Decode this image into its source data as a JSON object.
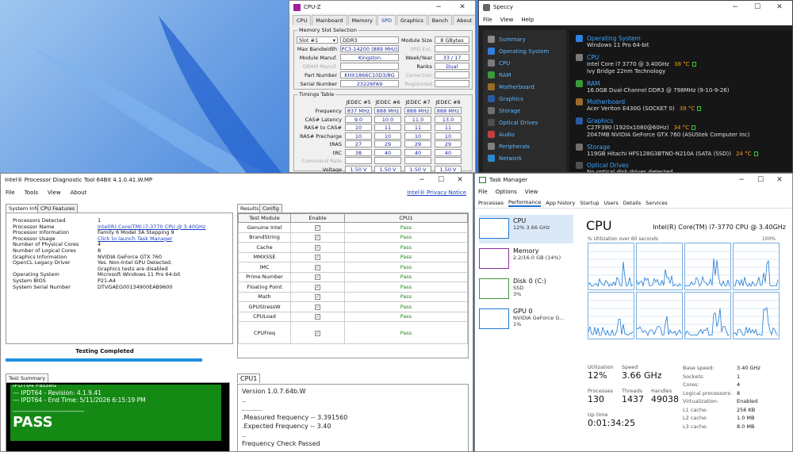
{
  "cpuz": {
    "title": "CPU-Z",
    "tabs": [
      "CPU",
      "Mainboard",
      "Memory",
      "SPD",
      "Graphics",
      "Bench",
      "About"
    ],
    "slot_group": "Memory Slot Selection",
    "slot": "Slot #1",
    "type": "DDR3",
    "module_size_label": "Module Size",
    "module_size": "8 GBytes",
    "max_bw_label": "Max Bandwidth",
    "max_bw": "PC3-14200 (889 MHz)",
    "spd_ext_label": "SPD Ext.",
    "manuf_label": "Module Manuf.",
    "manuf": "Kingston",
    "weekyear_label": "Week/Year",
    "weekyear": "33 / 17",
    "dram_label": "DRAM Manuf.",
    "ranks_label": "Ranks",
    "ranks": "Dual",
    "part_label": "Part Number",
    "part": "KHX1866C10D3/8G",
    "correction_label": "Correction",
    "serial_label": "Serial Number",
    "serial": "23226FA9",
    "registered_label": "Registered",
    "timings_group": "Timings Table",
    "timing_headers": [
      "JEDEC #5",
      "JEDEC #6",
      "JEDEC #7",
      "JEDEC #8"
    ],
    "timing_rows": [
      {
        "label": "Frequency",
        "vals": [
          "837 MHz",
          "888 MHz",
          "888 MHz",
          "888 MHz"
        ]
      },
      {
        "label": "CAS# Latency",
        "vals": [
          "9.0",
          "10.0",
          "11.0",
          "13.0"
        ]
      },
      {
        "label": "RAS# to CAS#",
        "vals": [
          "10",
          "11",
          "11",
          "11"
        ]
      },
      {
        "label": "RAS# Precharge",
        "vals": [
          "10",
          "10",
          "10",
          "10"
        ]
      },
      {
        "label": "tRAS",
        "vals": [
          "27",
          "29",
          "29",
          "29"
        ]
      },
      {
        "label": "tRC",
        "vals": [
          "38",
          "40",
          "40",
          "40"
        ]
      },
      {
        "label": "Command Rate",
        "vals": [
          "",
          "",
          "",
          ""
        ]
      },
      {
        "label": "Voltage",
        "vals": [
          "1.50 V",
          "1.50 V",
          "1.50 V",
          "1.50 V"
        ]
      }
    ]
  },
  "speccy": {
    "title": "Speccy",
    "menu": [
      "File",
      "View",
      "Help"
    ],
    "side": [
      {
        "label": "Summary",
        "color": "#8a8a8a"
      },
      {
        "label": "Operating System",
        "color": "#2f7fe0"
      },
      {
        "label": "CPU",
        "color": "#7a7a7a"
      },
      {
        "label": "RAM",
        "color": "#3a9a3a"
      },
      {
        "label": "Motherboard",
        "color": "#9a6a2a"
      },
      {
        "label": "Graphics",
        "color": "#2a5aa0"
      },
      {
        "label": "Storage",
        "color": "#707070"
      },
      {
        "label": "Optical Drives",
        "color": "#505050"
      },
      {
        "label": "Audio",
        "color": "#c04040"
      },
      {
        "label": "Peripherals",
        "color": "#808080"
      },
      {
        "label": "Network",
        "color": "#2a8ad0"
      }
    ],
    "sections": [
      {
        "head": "Operating System",
        "color": "#2f7fe0",
        "lines": [
          "Windows 11 Pro 64-bit"
        ]
      },
      {
        "head": "CPU",
        "color": "#7a7a7a",
        "lines": [
          "Intel Core i7 3770 @ 3.40GHz",
          "Ivy Bridge 22nm Technology"
        ],
        "temp": "38 °C"
      },
      {
        "head": "RAM",
        "color": "#3a9a3a",
        "lines": [
          "16.0GB Dual-Channel DDR3 @ 798MHz (9-10-9-26)"
        ]
      },
      {
        "head": "Motherboard",
        "color": "#9a6a2a",
        "lines": [
          "Acer Veriton E430G (SOCKET 0)"
        ],
        "temp": "39 °C"
      },
      {
        "head": "Graphics",
        "color": "#2a5aa0",
        "lines": [
          "C27F390 (1920x1080@60Hz)",
          "2047MB NVIDIA GeForce GTX 760 (ASUStek Computer Inc)"
        ],
        "temp": "34 °C"
      },
      {
        "head": "Storage",
        "color": "#707070",
        "lines": [
          "119GB Hitachi HFS128G3BTND-N210A (SATA (SSD))"
        ],
        "temp": "24 °C"
      },
      {
        "head": "Optical Drives",
        "color": "#505050",
        "lines": [
          "No optical disk drives detected"
        ]
      }
    ]
  },
  "ipdt": {
    "title": "Intel® Processor Diagnostic Tool 64Bit 4.1.0.41.W.MP",
    "menu": [
      "File",
      "Tools",
      "View",
      "About"
    ],
    "privacy": "Intel® Privacy Notice",
    "tab_sysinfo": "System Info",
    "tab_cpufeat": "CPU Features",
    "sysinfo": [
      [
        "Processors Detected",
        "1"
      ],
      [
        "Processor Name",
        "Intel(R) Core(TM) i7-3770 CPU @ 3.40GHz"
      ],
      [
        "Processor Information",
        "Family 6 Model 3A Stepping 9"
      ],
      [
        "Processor Usage",
        "Click to launch Task Manager"
      ],
      [
        "Number of Physical Cores",
        "4"
      ],
      [
        "Number of Logical Cores",
        "8"
      ],
      [
        "Graphics Information",
        "NVIDIA GeForce GTX 760"
      ],
      [
        "OpenCL Legacy Driver",
        "Yes. Non-Intel GPU Detected."
      ],
      [
        "",
        "Graphics tests are disabled"
      ],
      [
        "Operating System",
        "Microsoft Windows 11 Pro 64-bit"
      ],
      [
        "System BIOS",
        "P21-A4"
      ],
      [
        "System Serial Number",
        "DTVGAEG00134900EAB9600"
      ]
    ],
    "tab_results": "Results",
    "tab_config": "Config",
    "res_headers": [
      "Test Module",
      "Enable",
      "CPU1"
    ],
    "results": [
      {
        "name": "Genuine Intel",
        "res": "Pass"
      },
      {
        "name": "BrandString",
        "res": "Pass"
      },
      {
        "name": "Cache",
        "res": "Pass"
      },
      {
        "name": "MMXSSE",
        "res": "Pass"
      },
      {
        "name": "IMC",
        "res": "Pass"
      },
      {
        "name": "Prime Number",
        "res": "Pass"
      },
      {
        "name": "Floating Point",
        "res": "Pass"
      },
      {
        "name": "Math",
        "res": "Pass"
      },
      {
        "name": "GPUStressW",
        "res": "Pass"
      },
      {
        "name": "CPULoad",
        "res": "Pass"
      },
      {
        "name": "CPUFreq",
        "res": "Pass"
      }
    ],
    "testing_completed": "Testing Completed",
    "summary_tab": "Test Summary",
    "summary_lines": [
      "IPDT64 Passed",
      "--- IPDT64 - Revision: 4.1.9.41",
      "--- IPDT64 - End Time: 5/11/2026 6:15:19 PM",
      "________________________"
    ],
    "pass": "PASS",
    "cpu1_tab": "CPU1",
    "cpu1_lines": [
      "Version 1.0.7.64b.W",
      "..",
      "..........",
      ".Measured frequency -- 3.391560",
      ".Expected Frequency -- 3.40",
      "..",
      "Frequency Check Passed"
    ]
  },
  "tm": {
    "title": "Task Manager",
    "menu": [
      "File",
      "Options",
      "View"
    ],
    "tabs": [
      "Processes",
      "Performance",
      "App history",
      "Startup",
      "Users",
      "Details",
      "Services"
    ],
    "items": [
      {
        "name": "CPU",
        "sub": "12%  3.66 GHz",
        "color": "#1f7bd4"
      },
      {
        "name": "Memory",
        "sub": "2.2/16.0 GB (14%)",
        "color": "#8b2fa0"
      },
      {
        "name": "Disk 0 (C:)",
        "sub": "SSD",
        "sub2": "3%",
        "color": "#3a9a3a"
      },
      {
        "name": "GPU 0",
        "sub": "NVIDIA GeForce G...",
        "sub2": "1%",
        "color": "#1f7bd4"
      }
    ],
    "heading": "CPU",
    "cpu_name": "Intel(R) Core(TM) i7-3770 CPU @ 3.40GHz",
    "util_label": "% Utilization over 60 seconds",
    "util_max": "100%",
    "stats": {
      "utilization_label": "Utilization",
      "utilization": "12%",
      "speed_label": "Speed",
      "speed": "3.66 GHz",
      "processes_label": "Processes",
      "processes": "130",
      "threads_label": "Threads",
      "threads": "1437",
      "handles_label": "Handles",
      "handles": "49038",
      "uptime_label": "Up time",
      "uptime": "0:01:34:25"
    },
    "specs": [
      [
        "Base speed:",
        "3.40 GHz"
      ],
      [
        "Sockets:",
        "1"
      ],
      [
        "Cores:",
        "4"
      ],
      [
        "Logical processors:",
        "8"
      ],
      [
        "Virtualization:",
        "Enabled"
      ],
      [
        "L1 cache:",
        "256 KB"
      ],
      [
        "L2 cache:",
        "1.0 MB"
      ],
      [
        "L3 cache:",
        "8.0 MB"
      ]
    ]
  }
}
